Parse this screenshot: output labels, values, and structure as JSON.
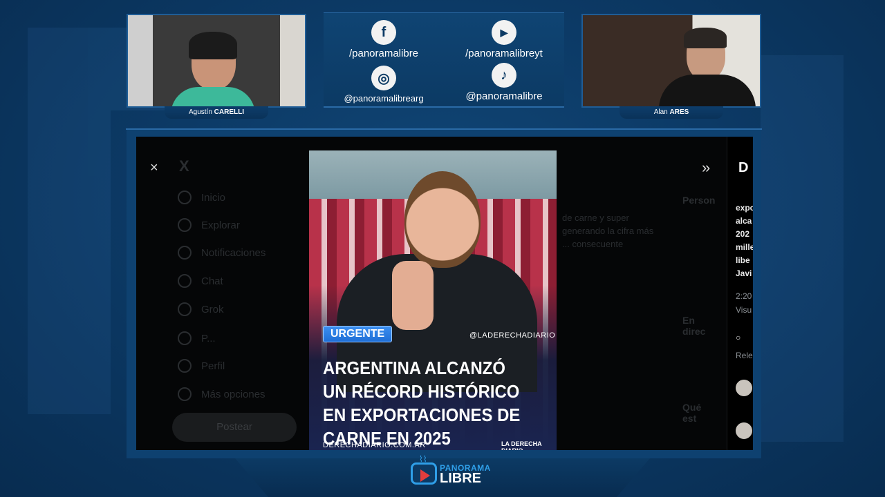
{
  "stream": {
    "host_left": {
      "first": "Agustín",
      "last": "CARELLI"
    },
    "host_right": {
      "first": "Alan",
      "last": "ARES"
    }
  },
  "socials": [
    {
      "icon": "facebook-icon",
      "glyph": "f",
      "handle": "/panoramalibre"
    },
    {
      "icon": "youtube-icon",
      "glyph": "▶",
      "handle": "/panoramalibreyt"
    },
    {
      "icon": "instagram-icon",
      "glyph": "◎",
      "handle": "@panoramalibrearg"
    },
    {
      "icon": "tiktok-icon",
      "glyph": "♪",
      "handle": "@panoramalibre"
    }
  ],
  "x_viewer": {
    "close": "×",
    "next": "»",
    "logo": "X",
    "nav": [
      "Inicio",
      "Explorar",
      "Notificaciones",
      "Chat",
      "Grok",
      "P...",
      "Perfil",
      "Más opciones"
    ],
    "post_button": "Postear",
    "ghost_lines": [
      "de carne y super",
      "generando la cifra más",
      "... consecuente"
    ],
    "right_col": [
      "Person",
      "En direc",
      "Qué est"
    ]
  },
  "post": {
    "badge": "URGENTE",
    "handle_tag": "@LADERECHADIARIO",
    "headline": "ARGENTINA ALCANZÓ UN RÉCORD HISTÓRICO EN EXPORTACIONES DE CARNE EN 2025",
    "footer_url": "DERECHADIARIO.COM.AR",
    "footer_brand": "LA DERECHA DIARIO"
  },
  "tweet_panel": {
    "brand": "D",
    "lines": [
      "expo",
      "alca",
      "202",
      "mille",
      "libe",
      "Javi"
    ],
    "time": "2:20",
    "views": "Visu",
    "reply": "Rele"
  },
  "brand": {
    "line1": "PANORAMA",
    "line2": "LIBRE",
    "accent": "#2f9fe8",
    "live_red": "#e23d3d"
  }
}
